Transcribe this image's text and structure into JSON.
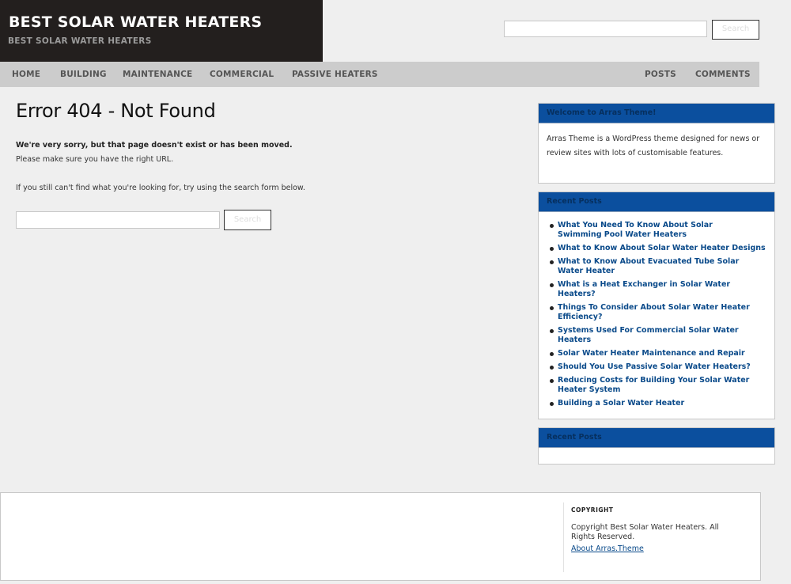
{
  "site": {
    "title": "BEST SOLAR WATER HEATERS",
    "tagline": "BEST SOLAR WATER HEATERS"
  },
  "header_search": {
    "button_label": "Search",
    "value": ""
  },
  "nav": {
    "items": [
      {
        "label": "HOME"
      },
      {
        "label": "BUILDING"
      },
      {
        "label": "MAINTENANCE"
      },
      {
        "label": "COMMERCIAL"
      },
      {
        "label": "PASSIVE HEATERS"
      },
      {
        "label": "POSTS"
      },
      {
        "label": "COMMENTS"
      }
    ]
  },
  "main": {
    "heading": "Error 404 - Not Found",
    "sorry_text": "We're very sorry, but that page doesn't exist or has been moved.",
    "url_text": "Please make sure you have the right URL.",
    "hint_text": "If you still can't find what you're looking for, try using the search form below.",
    "search_button_label": "Search"
  },
  "sidebar": {
    "welcome": {
      "title": "Welcome to Arras Theme!",
      "text": "Arras Theme is a WordPress theme designed for news or review sites with lots of customisable features."
    },
    "recent_posts": {
      "title": "Recent Posts",
      "items": [
        "What You Need To Know About Solar Swimming Pool Water Heaters",
        "What to Know About Solar Water Heater Designs",
        "What to Know About Evacuated Tube Solar Water Heater",
        "What is a Heat Exchanger in Solar Water Heaters?",
        "Things To Consider About Solar Water Heater Efficiency?",
        "Systems Used For Commercial Solar Water Heaters",
        "Solar Water Heater Maintenance and Repair",
        "Should You Use Passive Solar Water Heaters?",
        "Reducing Costs for Building Your Solar Water Heater System",
        "Building a Solar Water Heater"
      ]
    },
    "recent_posts_2": {
      "title": "Recent Posts"
    }
  },
  "footer": {
    "heading": "COPYRIGHT",
    "text": "Copyright Best Solar Water Heaters. All Rights Reserved.",
    "link": "About Arras.Theme"
  },
  "colors": {
    "brand_bg": "#231f1e",
    "nav_bg": "#cccccc",
    "widget_header": "#0b4f9e",
    "link": "#0a4a8a",
    "page_bg": "#efefef"
  }
}
